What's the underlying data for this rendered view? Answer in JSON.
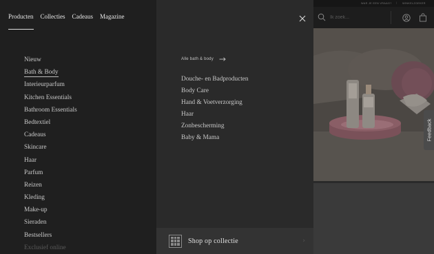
{
  "nav": {
    "tabs": [
      {
        "label": "Producten",
        "active": true
      },
      {
        "label": "Collecties",
        "active": false
      },
      {
        "label": "Cadeaus",
        "active": false
      },
      {
        "label": "Magazine",
        "active": false
      }
    ]
  },
  "categories": [
    {
      "label": "Nieuw"
    },
    {
      "label": "Bath & Body",
      "selected": true
    },
    {
      "label": "Interieurparfum"
    },
    {
      "label": "Kitchen Essentials"
    },
    {
      "label": "Bathroom Essentials"
    },
    {
      "label": "Bedtextiel"
    },
    {
      "label": "Cadeaus"
    },
    {
      "label": "Skincare"
    },
    {
      "label": "Haar"
    },
    {
      "label": "Parfum"
    },
    {
      "label": "Reizen"
    },
    {
      "label": "Kleding"
    },
    {
      "label": "Make-up"
    },
    {
      "label": "Sieraden"
    },
    {
      "label": "Bestsellers"
    },
    {
      "label": "Exclusief online",
      "faded": true
    }
  ],
  "submenu": {
    "all_link": "Alle bath & body",
    "items": [
      "Douche- en Badproducten",
      "Body Care",
      "Hand & Voetverzorging",
      "Haar",
      "Zonbescherming",
      "Baby & Mama"
    ],
    "shop_collection": "Shop op collectie"
  },
  "topbar": {
    "left_text": "WAR JE EEN VRAAG?",
    "separator": "|",
    "right_text": "WINKELZOEKER"
  },
  "search": {
    "placeholder": "Ik zoek..."
  },
  "feedback_label": "Feedback",
  "icons": {
    "close": "close-icon",
    "arrow": "arrow-right-icon",
    "search": "search-icon",
    "user": "user-icon",
    "bag": "shopping-bag-icon"
  }
}
